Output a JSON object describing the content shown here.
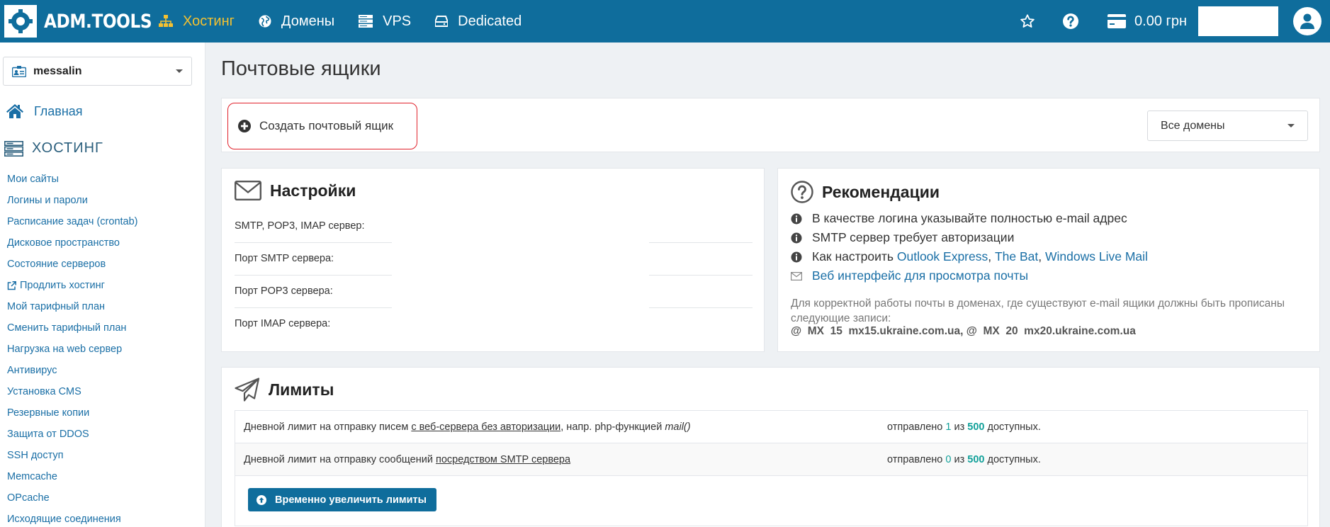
{
  "brand": {
    "logo_text": "ADM.TOOLS"
  },
  "nav": [
    {
      "label": "Хостинг",
      "icon": "sitemap-icon",
      "active": true
    },
    {
      "label": "Домены",
      "icon": "globe-icon",
      "active": false
    },
    {
      "label": "VPS",
      "icon": "server-icon",
      "active": false
    },
    {
      "label": "Dedicated",
      "icon": "hdd-icon",
      "active": false
    }
  ],
  "topbar": {
    "balance": "0.00 грн"
  },
  "sidebar": {
    "account": "messalin",
    "home": "Главная",
    "section_title": "ХОСТИНГ",
    "links": [
      "Мои сайты",
      "Логины и пароли",
      "Расписание задач (crontab)",
      "Дисковое пространство",
      "Состояние серверов",
      "Продлить хостинг",
      "Мой тарифный план",
      "Сменить тарифный план",
      "Нагрузка на web сервер",
      "Антивирус",
      "Установка CMS",
      "Резервные копии",
      "Защита от DDOS",
      "SSH доступ",
      "Memcache",
      "OPcache",
      "Исходящие соединения"
    ]
  },
  "main": {
    "title": "Почтовые ящики",
    "create_button": "Создать почтовый ящик",
    "domain_filter": "Все домены"
  },
  "settings": {
    "title": "Настройки",
    "rows": [
      "SMTP, POP3, IMAP сервер:",
      "Порт SMTP сервера:",
      "Порт POP3 сервера:",
      "Порт IMAP сервера:"
    ]
  },
  "recommendations": {
    "title": "Рекомендации",
    "item1": "В качестве логина указывайте полностью e-mail адрес",
    "item2": "SMTP сервер требует авторизации",
    "item3_prefix": "Как настроить",
    "item3_links": [
      "Outlook Express",
      "The Bat",
      "Windows Live Mail"
    ],
    "webmail_link": "Веб интерфейс для просмотра почты",
    "note": "Для корректной работы почты в доменах, где существуют e-mail ящики должны быть прописаны следующие записи:",
    "mx1": "@  MX  15  mx15.ukraine.com.ua",
    "mx2": "@  MX  20  mx20.ukraine.com.ua"
  },
  "limits": {
    "title": "Лимиты",
    "row1": {
      "prefix": "Дневной лимит на отправку писем ",
      "link": "с веб-сервера без авторизации",
      "suffix": ", напр. php-функцией ",
      "func": "mail()",
      "sent_prefix": "отправлено ",
      "sent": "1",
      "of": " из ",
      "limit": "500",
      "available": " доступных."
    },
    "row2": {
      "prefix": "Дневной лимит на отправку сообщений ",
      "link": "посредством SMTP сервера",
      "sent_prefix": "отправлено ",
      "sent": "0",
      "of": " из ",
      "limit": "500",
      "available": " доступных."
    },
    "button": "Временно увеличить лимиты"
  }
}
